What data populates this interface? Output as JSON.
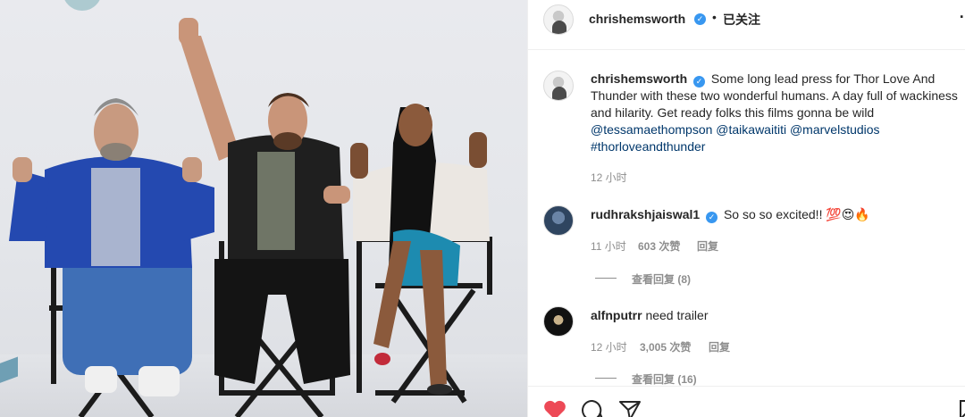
{
  "post": {
    "header": {
      "username": "chrishemsworth",
      "follow_state": "已关注",
      "separator": "•",
      "more": "…"
    },
    "caption": {
      "username": "chrishemsworth",
      "text": "Some long lead press for Thor Love And Thunder with these two wonderful humans. A day full of wackiness and hilarity. Get ready folks this films gonna be wild",
      "mention1": "@tessamaethompson",
      "mention2": "@taikawaititi",
      "mention3": "@marvelstudios",
      "hashtag": "#thorloveandthunder",
      "time": "12 小时"
    },
    "comments": [
      {
        "username": "rudhrakshjaiswal1",
        "text": "So so so excited!! 💯😍🔥",
        "time": "11 小时",
        "likes": "603 次赞",
        "reply": "回复",
        "view_replies": "查看回复 (8)"
      },
      {
        "username": "alfnputrr",
        "text": "need trailer",
        "time": "12 小时",
        "likes": "3,005 次赞",
        "reply": "回复",
        "view_replies": "查看回复 (16)"
      }
    ],
    "icons": {
      "like": "heart-filled-red",
      "comment": "comment-bubble",
      "share": "paper-plane"
    },
    "colors": {
      "like_red": "#ed4956",
      "verified_blue": "#3897f0",
      "link_blue": "#00376b",
      "muted": "#8e8e8e"
    }
  }
}
